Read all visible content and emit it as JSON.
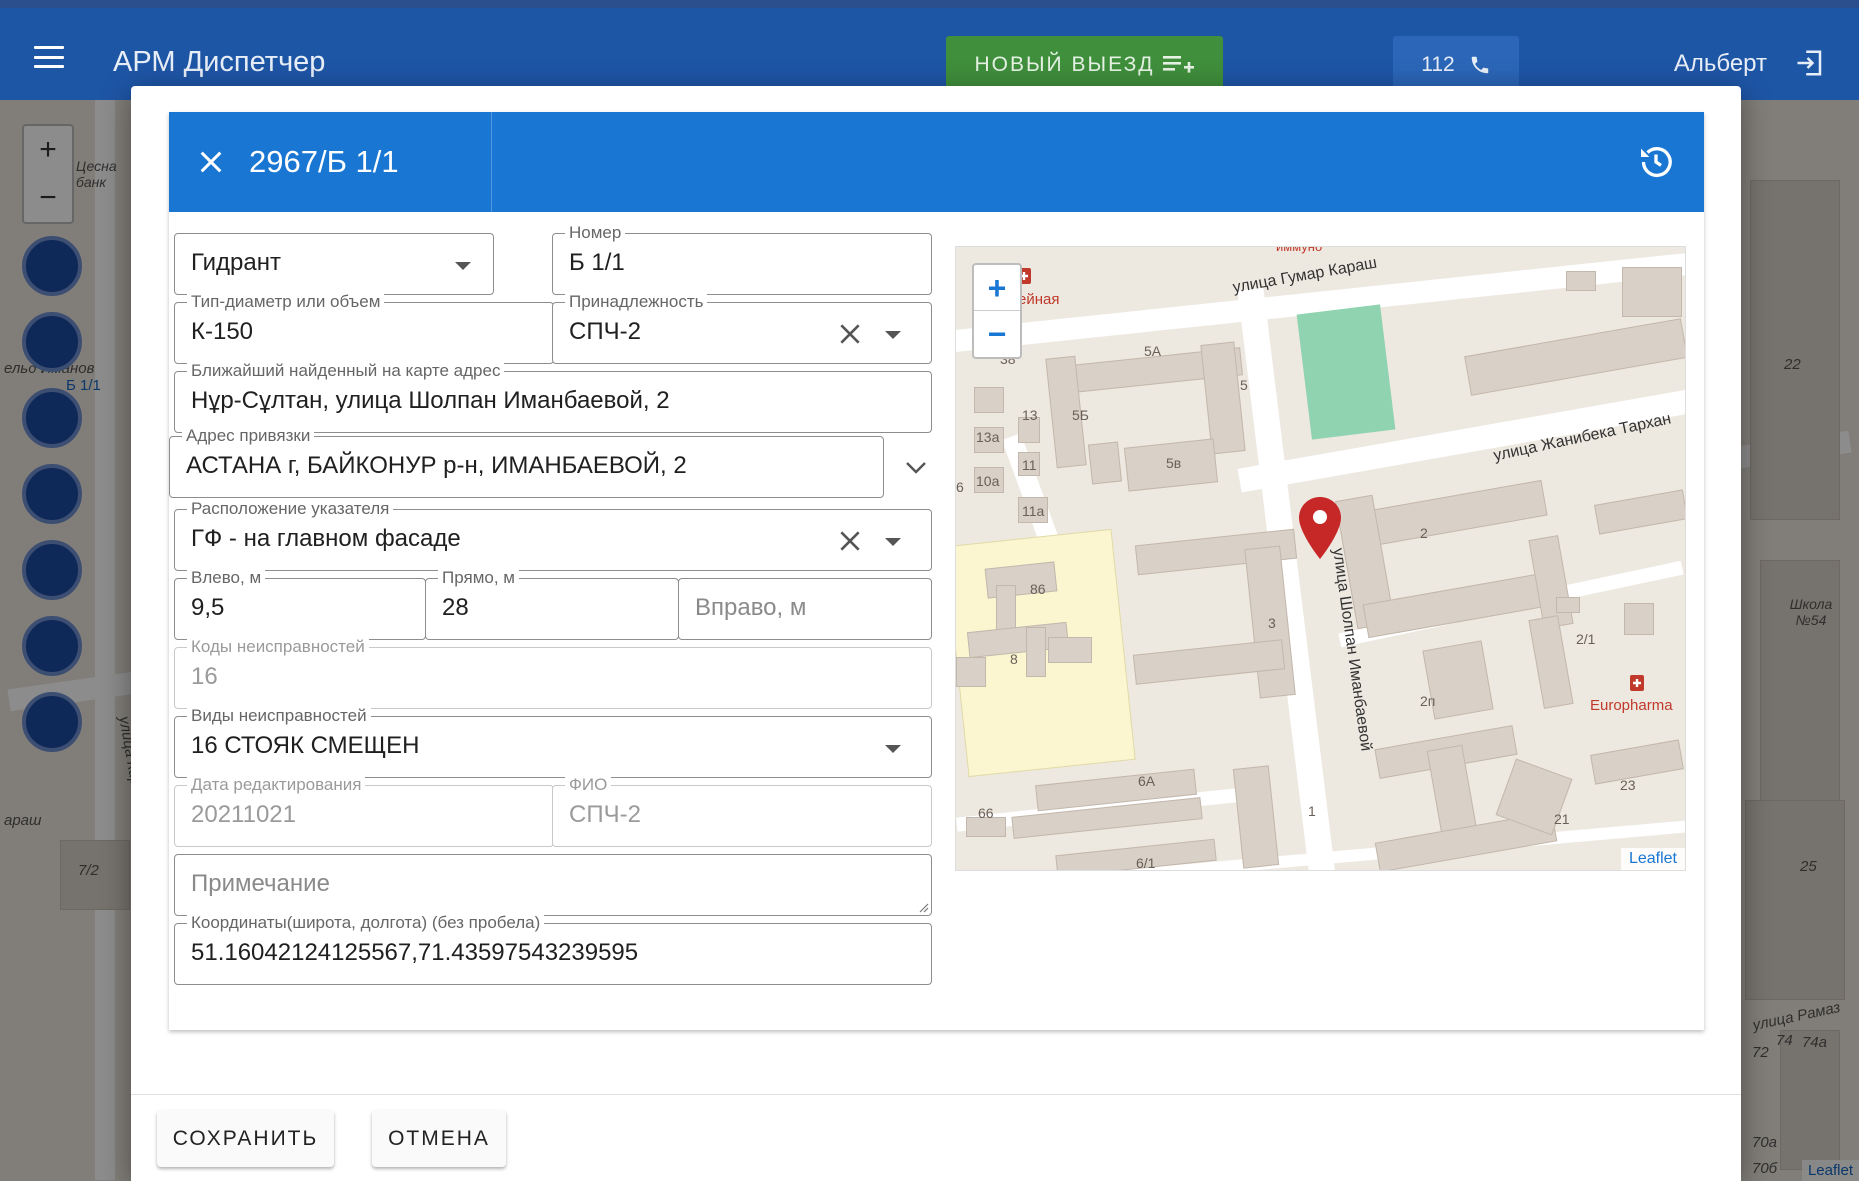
{
  "appbar": {
    "title": "АРМ Диспетчер",
    "new_call_label": "НОВЫЙ ВЫЕЗД",
    "phone_label": "112",
    "user_name": "Альберт"
  },
  "background_map": {
    "labels": [
      "Цесна банк",
      "улица Кирова",
      "ельд Иманов",
      "Б 1/1",
      "араш",
      "7/2",
      "22",
      "Школа №54",
      "25",
      "улица Рамаз",
      "72",
      "74",
      "74а",
      "70а",
      "70б"
    ],
    "attribution": "Leaflet"
  },
  "dialog": {
    "header_title": "2967/Б 1/1",
    "fields": {
      "type": {
        "value": "Гидрант"
      },
      "number": {
        "label": "Номер",
        "value": "Б 1/1"
      },
      "diameter": {
        "label": "Тип-диаметр или объем",
        "value": "К-150"
      },
      "ownership": {
        "label": "Принадлежность",
        "value": "СПЧ-2"
      },
      "nearest_address": {
        "label": "Ближайший найденный на карте адрес",
        "value": "Нұр-Сұлтан, улица Шолпан Иманбаевой, 2"
      },
      "bind_address": {
        "label": "Адрес привязки",
        "value": "АСТАНА г, БАЙКОНУР р-н, ИМАНБАЕВОЙ, 2"
      },
      "pointer_location": {
        "label": "Расположение указателя",
        "value": "ГФ - на главном фасаде"
      },
      "left_m": {
        "label": "Влево, м",
        "value": "9,5"
      },
      "straight_m": {
        "label": "Прямо, м",
        "value": "28"
      },
      "right_m": {
        "placeholder": "Вправо, м"
      },
      "fault_codes": {
        "label": "Коды неисправностей",
        "value": "16"
      },
      "fault_types": {
        "label": "Виды неисправностей",
        "value": "16 СТОЯК СМЕЩЕН"
      },
      "edit_date": {
        "label": "Дата редактирования",
        "value": "20211021"
      },
      "fio": {
        "label": "ФИО",
        "value": "СПЧ-2"
      },
      "note": {
        "placeholder": "Примечание"
      },
      "coords": {
        "label": "Координаты(широта, долгота) (без пробела)",
        "value": "51.16042124125567,71.43597543239595"
      }
    },
    "minimap": {
      "streets": [
        "улица Гумар Караш",
        "улица Жанибека Тархан",
        "улица Шолпан Иманбаевой"
      ],
      "pharmacy": "Europharma",
      "pharmacy2": "ейная",
      "top_label": "иммуно",
      "numbers": [
        "5А",
        "5",
        "5Б",
        "5в",
        "38",
        "13",
        "13а",
        "11",
        "10а",
        "11а",
        "6",
        "86",
        "8",
        "3",
        "2",
        "2/1",
        "2п",
        "6А",
        "66",
        "1",
        "21",
        "23",
        "6/1"
      ],
      "attribution": "Leaflet",
      "zoom_in": "+",
      "zoom_out": "−"
    },
    "buttons": {
      "save": "СОХРАНИТЬ",
      "cancel": "ОТМЕНА"
    }
  }
}
